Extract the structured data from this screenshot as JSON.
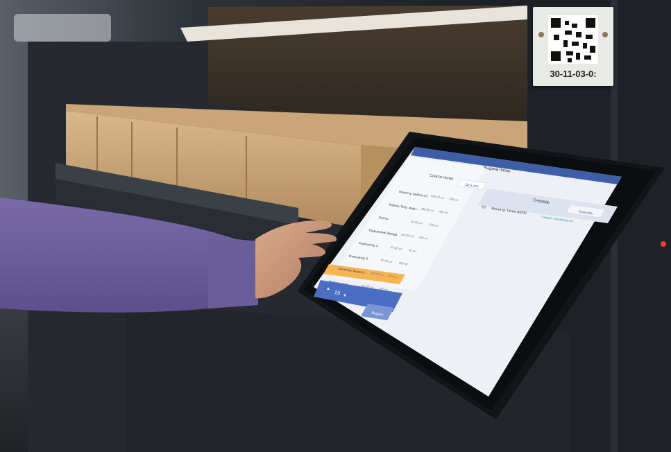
{
  "shelf_label": {
    "code": "30-11-03-0:"
  },
  "tablet": {
    "screen_title": "Выдача полки",
    "left_panel": {
      "header": "Список полки",
      "action_label": "Дать все",
      "items": [
        {
          "name": "Монитор Бейсик А1",
          "qty": "500,00 шт",
          "qty2": "320 шт"
        },
        {
          "name": "Кабель Тетр. медн...",
          "qty": "200,00 шт",
          "qty2": "450 шт"
        },
        {
          "name": "Болты",
          "qty": "40,00 шт",
          "qty2": "450 шт"
        },
        {
          "name": "Подшипник Завода",
          "qty": "120,00 шт",
          "qty2": "100 шт"
        },
        {
          "name": "Компьютер 2",
          "qty": "87,00 шт",
          "qty2": "20 шт"
        },
        {
          "name": "Компьютер 3",
          "qty": "87,00 шт",
          "qty2": "100 шт"
        },
        {
          "name": "Монитор Тихие К...",
          "qty": "400,00 шт",
          "qty2": "400 шт",
          "highlighted": true
        },
        {
          "name": "Материнская",
          "qty": "100,00 шт",
          "qty2": "100 шт"
        }
      ],
      "stepper_value": "20",
      "confirm_label": "Выдать"
    },
    "right_panel": {
      "header": "Очередь",
      "action_label": "Очистить",
      "items": [
        {
          "num": "20",
          "name": "Монитор Тихие 40000",
          "status": "Ожидает подтверждения"
        }
      ]
    }
  },
  "colors": {
    "accent_blue": "#4a6fc2",
    "highlight_orange": "#f5b553",
    "screen_bg": "#eef0f5"
  }
}
